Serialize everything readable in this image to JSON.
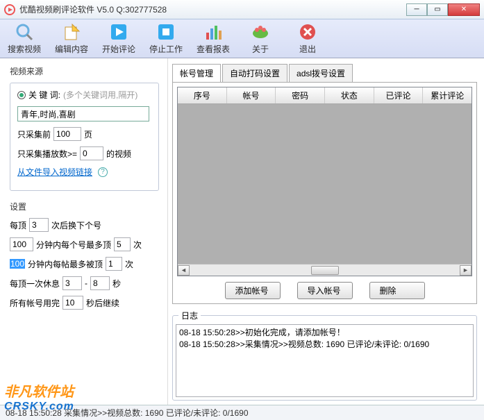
{
  "window": {
    "title": "优酷视频刷评论软件 V5.0  Q:302777528"
  },
  "toolbar": {
    "search": "搜索视频",
    "edit": "编辑内容",
    "start": "开始评论",
    "stop": "停止工作",
    "report": "查看报表",
    "about": "关于",
    "exit": "退出"
  },
  "left": {
    "source_title": "视频来源",
    "keyword_label": "关 键 词:",
    "keyword_hint": "(多个关键词用,隔开)",
    "keyword_value": "青年,时尚,喜剧",
    "collect_prefix": "只采集前",
    "collect_value": "100",
    "collect_suffix": "页",
    "playcount_prefix": "只采集播放数>=",
    "playcount_value": "0",
    "playcount_suffix": "的视频",
    "import_link": "从文件导入视频链接",
    "settings_title": "设置",
    "s1_a": "每顶",
    "s1_v": "3",
    "s1_b": "次后换下个号",
    "s2_v1": "100",
    "s2_a": "分钟内每个号最多顶",
    "s2_v2": "5",
    "s2_b": "次",
    "s3_v1": "100",
    "s3_a": "分钟内每帖最多被顶",
    "s3_v2": "1",
    "s3_b": "次",
    "s4_a": "每顶一次休息",
    "s4_v1": "3",
    "s4_mid": "-",
    "s4_v2": "8",
    "s4_b": "秒",
    "s5_a": "所有帐号用完",
    "s5_v": "10",
    "s5_b": "秒后继续"
  },
  "tabs": {
    "t1": "帐号管理",
    "t2": "自动打码设置",
    "t3": "adsl拨号设置"
  },
  "grid": {
    "cols": [
      "序号",
      "帐号",
      "密码",
      "状态",
      "已评论",
      "累计评论"
    ]
  },
  "buttons": {
    "add": "添加帐号",
    "import": "导入帐号",
    "delete": "删除"
  },
  "log": {
    "title": "日志",
    "line1": "08-18 15:50:28>>初始化完成，请添加帐号！",
    "line2": "08-18 15:50:28>>采集情况>>视频总数: 1690 已评论/未评论: 0/1690"
  },
  "status": "08-18 15:50:28 采集情况>>视频总数: 1690 已评论/未评论: 0/1690",
  "watermark": {
    "a": "非凡软件站",
    "b": "CRSKY.com"
  }
}
